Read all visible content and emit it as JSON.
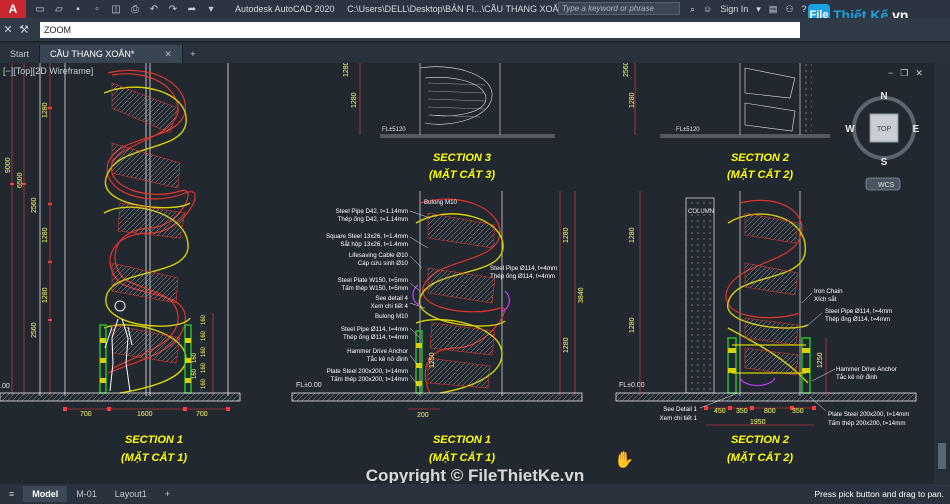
{
  "titlebar": {
    "logo": "A",
    "app_name": "Autodesk AutoCAD 2020",
    "file_path": "C:\\Users\\DELL\\Desktop\\BẢN FI...\\CẦU THANG XOẮN.dwg",
    "search_placeholder": "Type a keyword or phrase",
    "sign_in": "Sign In",
    "brand_mark": "File",
    "brand_name_1": "Thiết Kế",
    "brand_name_2": ".vn"
  },
  "command": {
    "current": "ZOOM"
  },
  "tabs": [
    {
      "label": "Start"
    },
    {
      "label": "CẦU THANG XOẮN*"
    }
  ],
  "viewport": {
    "label": "[−][Top][2D Wireframe]"
  },
  "viewcube": {
    "top": "TOP",
    "n": "N",
    "s": "S",
    "e": "E",
    "w": "W",
    "wcs": "WCS"
  },
  "layout_tabs": [
    {
      "label": "Model"
    },
    {
      "label": "M-01"
    },
    {
      "label": "Layout1"
    }
  ],
  "status": {
    "prompt": "Press pick button and drag to pan."
  },
  "watermark": "Copyright © FileThietKe.vn",
  "drawing": {
    "section1_left": {
      "title": "SECTION 1",
      "subtitle": "(MẶT CẮT 1)"
    },
    "section1_mid": {
      "title": "SECTION 1",
      "subtitle": "(MẶT CẮT 1)"
    },
    "section2_right": {
      "title": "SECTION 2",
      "subtitle": "(MẶT CẮT 2)"
    },
    "section3_top": {
      "title": "SECTION 3",
      "subtitle": "(MẶT CẮT 3)"
    },
    "section2_top": {
      "title": "SECTION 2",
      "subtitle": "(MẶT CẮT 2)"
    },
    "dims_left": [
      "9000",
      "6500",
      "2560",
      "1280",
      "1280",
      "1280",
      "2560",
      "700",
      "1600",
      "700"
    ],
    "dims_mid": [
      "3840",
      "1280",
      "1280",
      "1250",
      "200"
    ],
    "dims_right": [
      "1280",
      "1250",
      "450",
      "350",
      "800",
      "350",
      "1950",
      "2560",
      "1280"
    ],
    "fl_label": "FL±0.00",
    "fl_label_top": "FL±5120",
    "annotations_mid": [
      "Bulong M10",
      "Steel Pipe D42, t=1.14mm",
      "Thép ống D42, t=1.14mm",
      "Square Steel 13x26, t=1.4mm",
      "Sắt hộp 13x26, t=1.4mm",
      "Lifesaving Cable Ø10",
      "Cáp cứu sinh Ø10",
      "Steel Plate W150, t=5mm",
      "Tấm thép W150, t=5mm",
      "See detail 4",
      "Xem chi tiết 4",
      "Bulong M10",
      "Steel Pipe Ø114, t=4mm",
      "Thép ống Ø114, t=4mm",
      "Hammer Drive Anchor",
      "Tắc kê nở đinh",
      "Plate Steel 200x200, t=14mm",
      "Tấm thép 200x200, t=14mm"
    ],
    "annotations_mid_right": [
      "Steel Pipe Ø114, t=4mm",
      "Thép ống Ø114, t=4mm"
    ],
    "annotations_right": [
      "Iron Chain",
      "Xích sắt",
      "Steel Pipe Ø114, t=4mm",
      "Thép ống Ø114, t=4mm",
      "Hammer Drive Anchor",
      "Tắc kê nở đinh",
      "Plate Steel 200x200, t=14mm",
      "Tấm thép 200x200, t=14mm"
    ],
    "see_detail": [
      "See Detail 1",
      "Xem chi tiết 1"
    ],
    "column_label": "COLUMN"
  },
  "colors": {
    "background": "#212830",
    "section_text": "#ffff00",
    "stairs_red": "#e0332b",
    "rail_yellow": "#d8d000",
    "dim_red": "#ff3b3b",
    "green": "#22cc22",
    "white_lines": "#e8e8e8"
  }
}
